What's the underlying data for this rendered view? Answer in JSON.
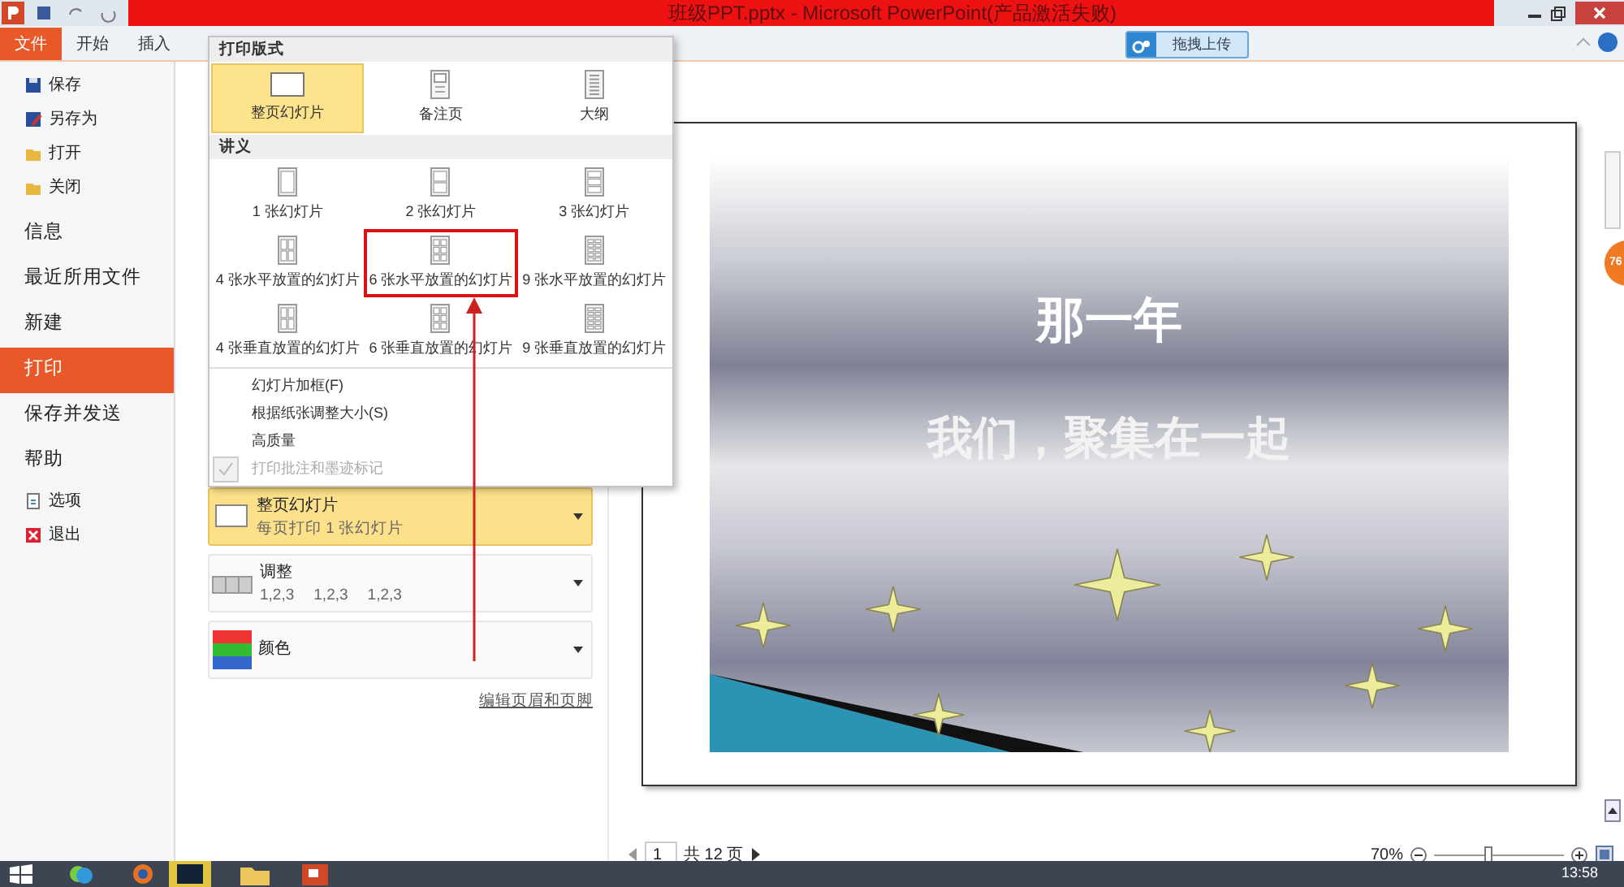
{
  "window": {
    "title": "班级PPT.pptx - Microsoft PowerPoint(产品激活失败)"
  },
  "ribbon_tabs": [
    {
      "label": "文件",
      "selected": true
    },
    {
      "label": "开始",
      "selected": false
    },
    {
      "label": "插入",
      "selected": false
    }
  ],
  "upload_button": {
    "label": "拖拽上传"
  },
  "sidebar": {
    "items": [
      {
        "label": "保存",
        "kind": "command",
        "selected": false
      },
      {
        "label": "另存为",
        "kind": "command",
        "selected": false
      },
      {
        "label": "打开",
        "kind": "command",
        "selected": false
      },
      {
        "label": "关闭",
        "kind": "command",
        "selected": false
      },
      {
        "label": "信息",
        "kind": "section",
        "selected": false
      },
      {
        "label": "最近所用文件",
        "kind": "section",
        "selected": false
      },
      {
        "label": "新建",
        "kind": "section",
        "selected": false
      },
      {
        "label": "打印",
        "kind": "section",
        "selected": true
      },
      {
        "label": "保存并发送",
        "kind": "section",
        "selected": false
      },
      {
        "label": "帮助",
        "kind": "section",
        "selected": false
      },
      {
        "label": "选项",
        "kind": "command",
        "selected": false
      },
      {
        "label": "退出",
        "kind": "command",
        "selected": false
      }
    ]
  },
  "layout_menu": {
    "sections": [
      {
        "title": "打印版式",
        "items": [
          {
            "label": "整页幻灯片",
            "selected": true,
            "highlighted": false
          },
          {
            "label": "备注页",
            "selected": false,
            "highlighted": false
          },
          {
            "label": "大纲",
            "selected": false,
            "highlighted": false
          }
        ]
      },
      {
        "title": "讲义",
        "items": [
          {
            "label": "1 张幻灯片",
            "selected": false,
            "highlighted": false
          },
          {
            "label": "2 张幻灯片",
            "selected": false,
            "highlighted": false
          },
          {
            "label": "3 张幻灯片",
            "selected": false,
            "highlighted": false
          },
          {
            "label": "4 张水平放置的幻灯片",
            "selected": false,
            "highlighted": false
          },
          {
            "label": "6 张水平放置的幻灯片",
            "selected": false,
            "highlighted": true
          },
          {
            "label": "9 张水平放置的幻灯片",
            "selected": false,
            "highlighted": false
          },
          {
            "label": "4 张垂直放置的幻灯片",
            "selected": false,
            "highlighted": false
          },
          {
            "label": "6 张垂直放置的幻灯片",
            "selected": false,
            "highlighted": false
          },
          {
            "label": "9 张垂直放置的幻灯片",
            "selected": false,
            "highlighted": false
          }
        ]
      }
    ],
    "options": [
      {
        "label": "幻灯片加框(F)",
        "checked": false,
        "disabled": false
      },
      {
        "label": "根据纸张调整大小(S)",
        "checked": false,
        "disabled": false
      },
      {
        "label": "高质量",
        "checked": false,
        "disabled": false
      },
      {
        "label": "打印批注和墨迹标记",
        "checked": true,
        "disabled": true
      }
    ]
  },
  "print_settings": [
    {
      "kind": "layout",
      "title": "整页幻灯片",
      "subtitle": "每页打印 1 张幻灯片",
      "selected": true
    },
    {
      "kind": "collate",
      "title": "调整",
      "details": [
        "1,2,3",
        "1,2,3",
        "1,2,3"
      ],
      "selected": false
    },
    {
      "kind": "color",
      "title": "颜色",
      "selected": false
    }
  ],
  "header_footer_link": "编辑页眉和页脚",
  "preview": {
    "slide": {
      "title": "那一年",
      "subtitle": "我们，聚集在一起"
    },
    "page": "1",
    "page_total": "共 12 页",
    "zoom": "70%",
    "zoom_slider": {
      "level": 0.42
    }
  },
  "floating_badge": "76",
  "taskbar": {
    "clock": "13:58"
  }
}
